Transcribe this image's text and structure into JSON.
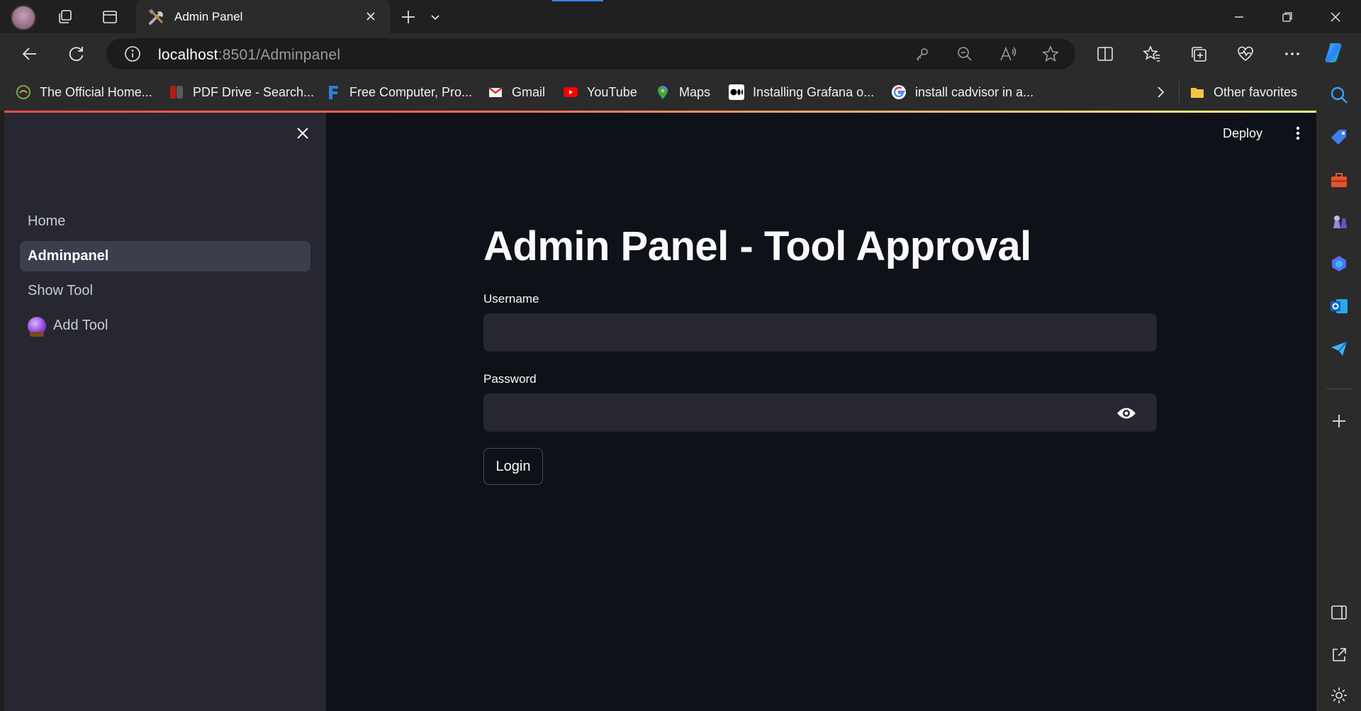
{
  "browser": {
    "tab": {
      "title": "Admin Panel",
      "icon": "tools-icon"
    },
    "url": {
      "host": "localhost",
      "path": ":8501/Adminpanel"
    },
    "favorites": [
      {
        "label": "The Official Home...",
        "icon": "tomcat-icon"
      },
      {
        "label": "PDF Drive - Search...",
        "icon": "pdf-drive-icon"
      },
      {
        "label": "Free Computer, Pro...",
        "icon": "f-letter-icon"
      },
      {
        "label": "Gmail",
        "icon": "gmail-icon"
      },
      {
        "label": "YouTube",
        "icon": "youtube-icon"
      },
      {
        "label": "Maps",
        "icon": "maps-pin-icon"
      },
      {
        "label": "Installing Grafana o...",
        "icon": "medium-icon"
      },
      {
        "label": "install cadvisor in a...",
        "icon": "google-icon"
      }
    ],
    "other_favorites": "Other favorites"
  },
  "sidebar": {
    "items": [
      {
        "label": "Home",
        "active": false
      },
      {
        "label": "Adminpanel",
        "active": true
      },
      {
        "label": "Show Tool",
        "active": false
      },
      {
        "label": "Add Tool",
        "active": false,
        "icon": "crystal-ball-icon"
      }
    ]
  },
  "header": {
    "deploy_label": "Deploy"
  },
  "main": {
    "title": "Admin Panel - Tool Approval",
    "username_label": "Username",
    "username_value": "",
    "password_label": "Password",
    "password_value": "",
    "login_label": "Login"
  },
  "colors": {
    "app_background": "#0e1117",
    "sidebar_background": "#262730",
    "input_background": "#262730",
    "accent_gradient_start": "#ff4b4b",
    "accent_gradient_end": "#fffd80"
  }
}
